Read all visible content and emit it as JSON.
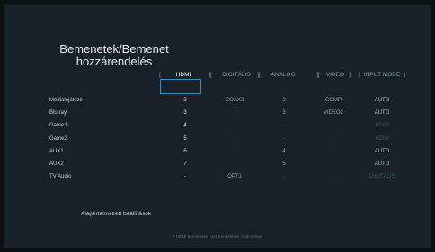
{
  "page": {
    "title_line1": "Bemenetek/Bemenet",
    "title_line2": "hozzárendelés"
  },
  "columns": [
    {
      "label": "HDMI",
      "active": true
    },
    {
      "label": "DIGITÁLIS",
      "active": false
    },
    {
      "label": "ANALOG",
      "active": false
    },
    {
      "label": "VIDEÓ",
      "active": false
    },
    {
      "label": "INPUT MODE",
      "active": false
    }
  ],
  "column_brackets": [
    "[",
    "][",
    "][",
    "][",
    "]",
    "[",
    "]"
  ],
  "rows": [
    {
      "name": "Médialejátszó",
      "hdmi": "2",
      "digital": "COAX2",
      "analog": "2",
      "video": "COMP",
      "mode": "AUTO"
    },
    {
      "name": "Blu-ray",
      "hdmi": "3",
      "digital": "-",
      "analog": "3",
      "video": "VIDEO2",
      "mode": "AUTO"
    },
    {
      "name": "Game1",
      "hdmi": "4",
      "digital": "-",
      "analog": "-",
      "video": "-",
      "mode": "HDMI"
    },
    {
      "name": "Game2",
      "hdmi": "5",
      "digital": "-",
      "analog": "-",
      "video": "-",
      "mode": "HDMI"
    },
    {
      "name": "AUX1",
      "hdmi": "6",
      "digital": "-",
      "analog": "4",
      "video": "-",
      "mode": "AUTO"
    },
    {
      "name": "AUX2",
      "hdmi": "7",
      "digital": "-",
      "analog": "5",
      "video": "-",
      "mode": "AUTO"
    },
    {
      "name": "TV Audio",
      "hdmi": "-",
      "digital": "OPT1",
      "analog": "-",
      "video": "-",
      "mode": "DIGITÁLIS"
    }
  ],
  "footer": {
    "defaults_label": "Alapértelmezett beállítások",
    "hint": "A HDMI bemenetek hozzárendelések módosítása."
  },
  "colors": {
    "background": "#172127",
    "cursor": "#3f8bb5",
    "text": "#c6ced2"
  }
}
